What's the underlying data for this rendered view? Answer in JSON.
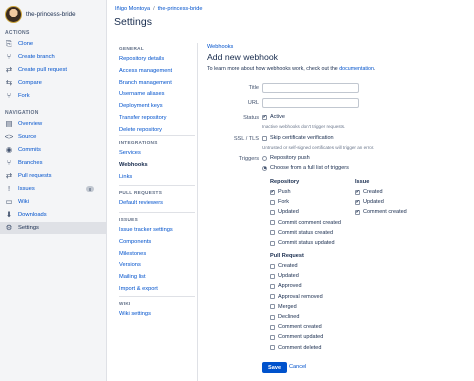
{
  "repo": {
    "name": "the-princess-bride"
  },
  "left_nav": {
    "actions_heading": "ACTIONS",
    "actions": [
      {
        "label": "Clone",
        "icon": "clone-icon",
        "glyph": "⎘"
      },
      {
        "label": "Create branch",
        "icon": "branch-icon",
        "glyph": "⑂"
      },
      {
        "label": "Create pull request",
        "icon": "pull-request-icon",
        "glyph": "⇄"
      },
      {
        "label": "Compare",
        "icon": "compare-icon",
        "glyph": "⇆"
      },
      {
        "label": "Fork",
        "icon": "fork-icon",
        "glyph": "⑂"
      }
    ],
    "navigation_heading": "NAVIGATION",
    "navigation": [
      {
        "label": "Overview",
        "icon": "overview-icon",
        "glyph": "▤"
      },
      {
        "label": "Source",
        "icon": "source-icon",
        "glyph": "<>"
      },
      {
        "label": "Commits",
        "icon": "commits-icon",
        "glyph": "◉"
      },
      {
        "label": "Branches",
        "icon": "branches-icon",
        "glyph": "⑂"
      },
      {
        "label": "Pull requests",
        "icon": "pull-requests-icon",
        "glyph": "⇄"
      },
      {
        "label": "Issues",
        "icon": "issues-icon",
        "glyph": "!",
        "badge": "8"
      },
      {
        "label": "Wiki",
        "icon": "wiki-icon",
        "glyph": "▭"
      },
      {
        "label": "Downloads",
        "icon": "downloads-icon",
        "glyph": "⬇"
      },
      {
        "label": "Settings",
        "icon": "settings-icon",
        "glyph": "⚙",
        "selected": true
      }
    ]
  },
  "header": {
    "breadcrumb_user": "Iñigo Montoya",
    "breadcrumb_sep": "/",
    "breadcrumb_repo": "the-princess-bride",
    "title": "Settings"
  },
  "settings_menu": {
    "general_heading": "GENERAL",
    "general": [
      "Repository details",
      "Access management",
      "Branch management",
      "Username aliases",
      "Deployment keys",
      "Transfer repository",
      "Delete repository"
    ],
    "integrations_heading": "INTEGRATIONS",
    "integrations": [
      "Services",
      "Webhooks",
      "Links"
    ],
    "pull_requests_heading": "PULL REQUESTS",
    "pull_requests": [
      "Default reviewers"
    ],
    "issues_heading": "ISSUES",
    "issues": [
      "Issue tracker settings",
      "Components",
      "Milestones",
      "Versions",
      "Mailing list",
      "Import & export"
    ],
    "wiki_heading": "WIKI",
    "wiki": [
      "Wiki settings"
    ]
  },
  "webhook_form": {
    "breadcrumb": "Webhooks",
    "title": "Add new webhook",
    "intro_text": "To learn more about how webhooks work, check out the ",
    "intro_link": "documentation",
    "intro_end": ".",
    "title_label": "Title",
    "title_value": "",
    "url_label": "URL",
    "url_value": "",
    "status_label": "Status",
    "status_option": "Active",
    "status_checked": true,
    "status_helper": "Inactive webhooks don't trigger requests.",
    "ssl_label": "SSL / TLS",
    "ssl_option": "Skip certificate verification",
    "ssl_checked": false,
    "ssl_helper": "Untrusted or self-signed certificates will trigger an error.",
    "triggers_label": "Triggers",
    "trigger_push": "Repository push",
    "trigger_choose": "Choose from a full list of triggers",
    "trigger_selected": "choose",
    "repository_heading": "Repository",
    "repository_triggers": [
      {
        "label": "Push",
        "checked": true
      },
      {
        "label": "Fork",
        "checked": false
      },
      {
        "label": "Updated",
        "checked": false
      },
      {
        "label": "Commit comment created",
        "checked": false
      },
      {
        "label": "Commit status created",
        "checked": false
      },
      {
        "label": "Commit status updated",
        "checked": false
      }
    ],
    "issue_heading": "Issue",
    "issue_triggers": [
      {
        "label": "Created",
        "checked": true
      },
      {
        "label": "Updated",
        "checked": true
      },
      {
        "label": "Comment created",
        "checked": true
      }
    ],
    "pull_request_heading": "Pull Request",
    "pull_request_triggers": [
      {
        "label": "Created",
        "checked": false
      },
      {
        "label": "Updated",
        "checked": false
      },
      {
        "label": "Approved",
        "checked": false
      },
      {
        "label": "Approval removed",
        "checked": false
      },
      {
        "label": "Merged",
        "checked": false
      },
      {
        "label": "Declined",
        "checked": false
      },
      {
        "label": "Comment created",
        "checked": false
      },
      {
        "label": "Comment updated",
        "checked": false
      },
      {
        "label": "Comment deleted",
        "checked": false
      }
    ],
    "save_label": "Save",
    "cancel_label": "Cancel"
  }
}
